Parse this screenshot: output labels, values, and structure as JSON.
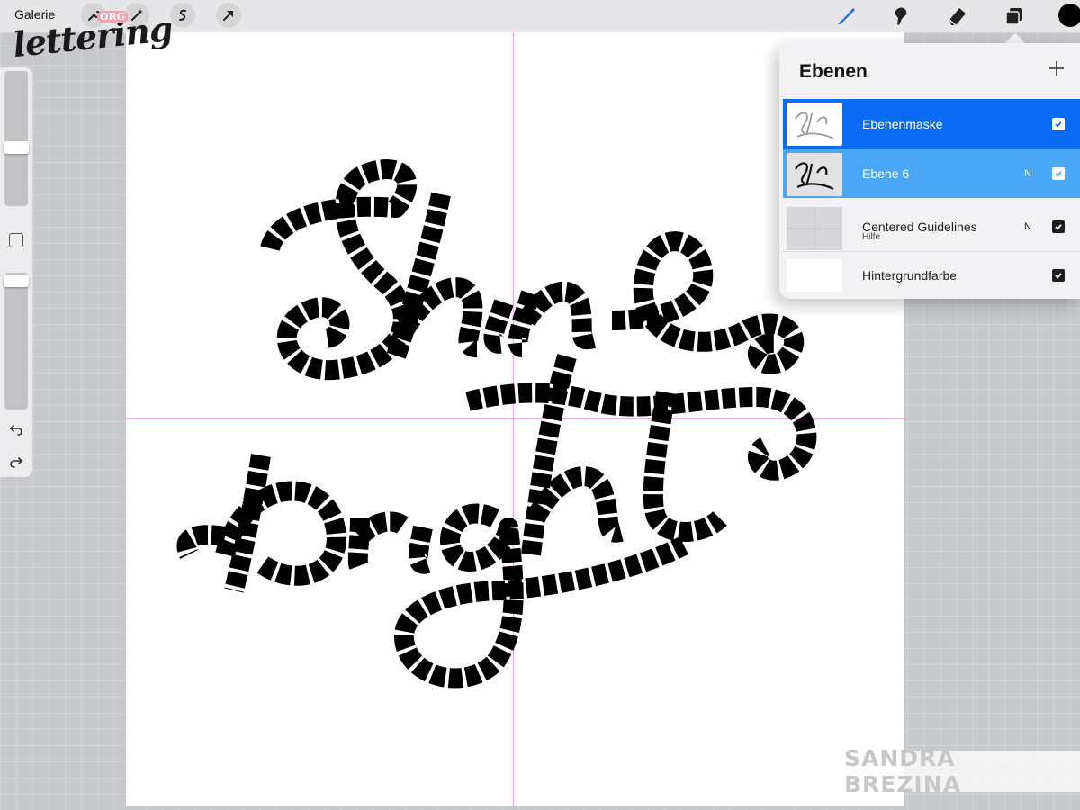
{
  "topbar": {
    "gallery_label": "Galerie",
    "logo_text": "lettering",
    "logo_badge": "ORG",
    "left_tools": [
      "wrench-icon",
      "magic-wand-icon",
      "selection-icon",
      "transform-arrow-icon"
    ],
    "right_tools": [
      "brush-icon",
      "smudge-icon",
      "eraser-icon",
      "layers-icon"
    ],
    "active_tool": "brush-icon",
    "current_color": "#000000"
  },
  "sidebar": {
    "brush_size_level": 0.58,
    "opacity_level": 0.95
  },
  "canvas": {
    "artwork_text": "Shine bright",
    "guide_color": "#f0a8e6"
  },
  "layers_panel": {
    "title": "Ebenen",
    "layers": [
      {
        "name": "Ebenenmaske",
        "sub": "",
        "blend": "",
        "checked": true,
        "state": "mask"
      },
      {
        "name": "Ebene 6",
        "sub": "",
        "blend": "N",
        "checked": true,
        "state": "active"
      },
      {
        "name": "Centered Guidelines",
        "sub": "Hilfe",
        "blend": "N",
        "checked": true,
        "state": "normal"
      },
      {
        "name": "Hintergrundfarbe",
        "sub": "",
        "blend": "",
        "checked": true,
        "state": "normal"
      }
    ]
  },
  "watermark": "SANDRA BREZINA",
  "colors": {
    "accent": "#0a6cf5",
    "active_layer": "#4aa7f5",
    "tool_active": "#1f6fe0"
  }
}
